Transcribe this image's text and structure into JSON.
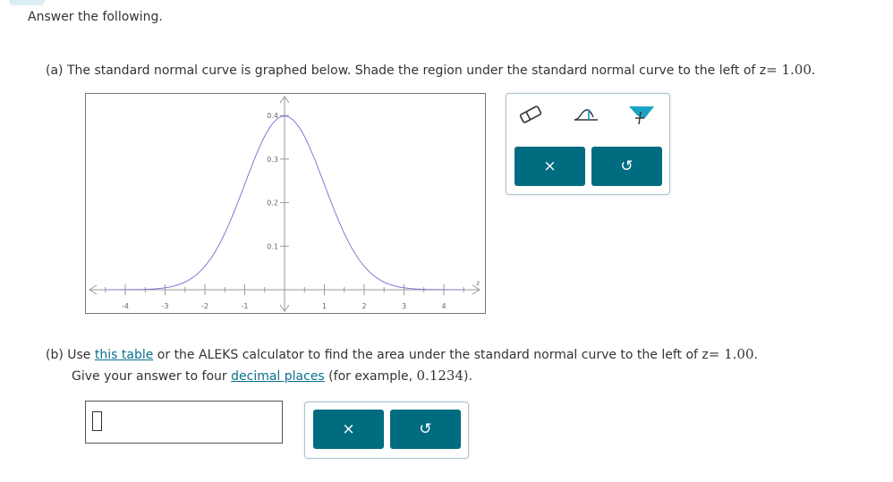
{
  "intro": "Answer the following.",
  "part_a": {
    "prefix": "(a) The standard normal curve is graphed below. Shade the region under the standard normal curve to the left of z",
    "eq": "= 1.00",
    "suffix": "."
  },
  "graph": {
    "x_ticks": [
      "-4",
      "-3",
      "-2",
      "-1",
      "1",
      "2",
      "3",
      "4"
    ],
    "y_ticks": [
      "0.1",
      "0.2",
      "0.3",
      "0.4"
    ],
    "axis_label": "z",
    "curve_color": "#7b7bd8",
    "axis_color": "#9a9a9a"
  },
  "tools": {
    "icons": [
      "eraser-icon",
      "left-region-icon",
      "shade-region-icon"
    ],
    "clear_label": "×",
    "undo_label": "↺"
  },
  "part_b": {
    "line1_prefix": "(b) Use ",
    "link1": "this table",
    "line1_mid": " or the ALEKS calculator to find the area under the standard normal curve to the left of z",
    "eq": "= 1.00",
    "line1_suffix": ".",
    "line2_prefix": "Give your answer to four ",
    "link2": "decimal places",
    "line2_mid": " (for example, ",
    "example": "0.1234",
    "line2_suffix": ")."
  },
  "answer": {
    "value": ""
  },
  "colors": {
    "accent": "#006c80",
    "link": "#0a6f8f",
    "panel_border": "#a9c4d1",
    "shade_fill": "#1ba3c4"
  }
}
